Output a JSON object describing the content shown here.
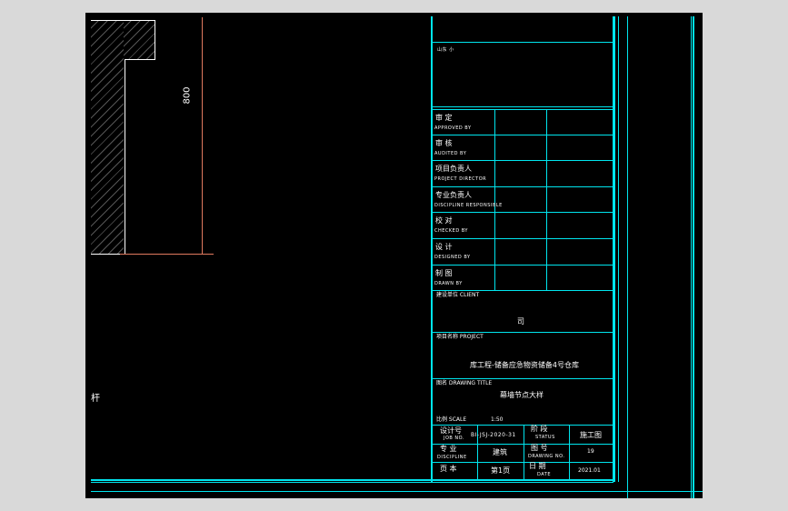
{
  "drawing": {
    "dimension": "800",
    "side_label": "杆"
  },
  "title_block": {
    "top_label": "山东 小",
    "signatures": [
      {
        "cn": "审 定",
        "en": "APPROVED BY"
      },
      {
        "cn": "审 核",
        "en": "AUDITED BY"
      },
      {
        "cn": "项目负责人",
        "en": "PROJECT DIRECTOR"
      },
      {
        "cn": "专业负责人",
        "en": "DISCIPLINE RESPONSIBLE"
      },
      {
        "cn": "校 对",
        "en": "CHECKED BY"
      },
      {
        "cn": "设 计",
        "en": "DESIGNED BY"
      },
      {
        "cn": "制 图",
        "en": "DRAWN BY"
      }
    ],
    "client_label": "建设单位 CLIENT",
    "client_value": "司",
    "project_label": "项目名称 PROJECT",
    "project_value": "库工程-储备应急物资储备4号仓库",
    "title_label": "图名 DRAWING TITLE",
    "title_value": "幕墙节点大样",
    "scale_label": "比例 SCALE",
    "scale_value": "1:50",
    "job_cn": "设计号",
    "job_en": "JOB NO.",
    "job_value": "BI-JSJ-2020-31",
    "status_cn": "阶 段",
    "status_en": "STATUS",
    "status_value": "施工图",
    "disc_cn": "专 业",
    "disc_en": "DISCIPLINE",
    "disc_value": "建筑",
    "dwg_cn": "图 号",
    "dwg_en": "DRAWING NO.",
    "dwg_value": "19",
    "page_cn": "页 本",
    "page_value": "第1页",
    "date_cn": "日 期",
    "date_en": "DATE",
    "date_value": "2021.01"
  },
  "colors": {
    "frame": "#00e5ee",
    "dimension": "#e07a5f",
    "background": "#000000"
  }
}
